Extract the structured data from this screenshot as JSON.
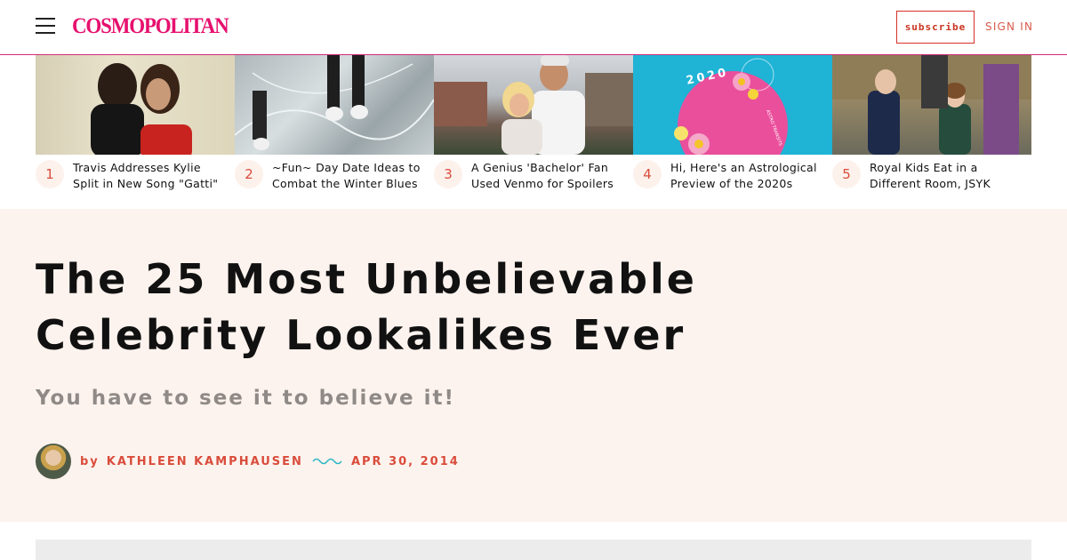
{
  "header": {
    "logo": "COSMOPOLITAN",
    "subscribe_label": "subscribe",
    "signin_label": "SIGN IN",
    "brand_color": "#e6106e",
    "accent_color": "#d94c3b"
  },
  "trending": [
    {
      "number": "1",
      "title": "Travis Addresses Kylie Split in New Song \"Gatti\""
    },
    {
      "number": "2",
      "title": "~Fun~ Day Date Ideas to Combat the Winter Blues"
    },
    {
      "number": "3",
      "title": "A Genius 'Bachelor' Fan Used Venmo for Spoilers"
    },
    {
      "number": "4",
      "title": "Hi, Here's an Astrological Preview of the 2020s"
    },
    {
      "number": "5",
      "title": "Royal Kids Eat in a Different Room, JSYK"
    }
  ],
  "thumb4": {
    "year": "2020",
    "tagline": "ASTRO TRANSITS"
  },
  "article": {
    "headline": "The 25 Most Unbelievable Celebrity Lookalikes Ever",
    "dek": "You have to see it to believe it!",
    "byline_prefix": "by",
    "author": "KATHLEEN KAMPHAUSEN",
    "date": "APR 30, 2014"
  },
  "icons": {
    "menu": "hamburger-menu-icon",
    "squiggle": "wave-divider-icon"
  }
}
